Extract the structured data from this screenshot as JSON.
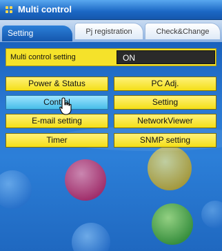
{
  "window": {
    "title": "Multi control"
  },
  "tabs": [
    {
      "label": "Setting",
      "active": true
    },
    {
      "label": "Pj registration",
      "active": false
    },
    {
      "label": "Check&Change",
      "active": false
    }
  ],
  "multi_control_setting": {
    "label": "Multi control setting",
    "value": "ON"
  },
  "buttons": {
    "power_status": "Power & Status",
    "pc_adj": "PC Adj.",
    "control": "Control",
    "setting": "Setting",
    "email_setting": "E-mail setting",
    "network_viewer": "NetworkViewer",
    "timer": "Timer",
    "snmp_setting": "SNMP setting"
  },
  "colors": {
    "accent_yellow": "#f4df17",
    "selected_blue": "#47bde9",
    "panel_blue": "#2c7fd8"
  },
  "icons": {
    "title": "grid-dots-icon",
    "cursor": "hand-pointer-icon"
  }
}
